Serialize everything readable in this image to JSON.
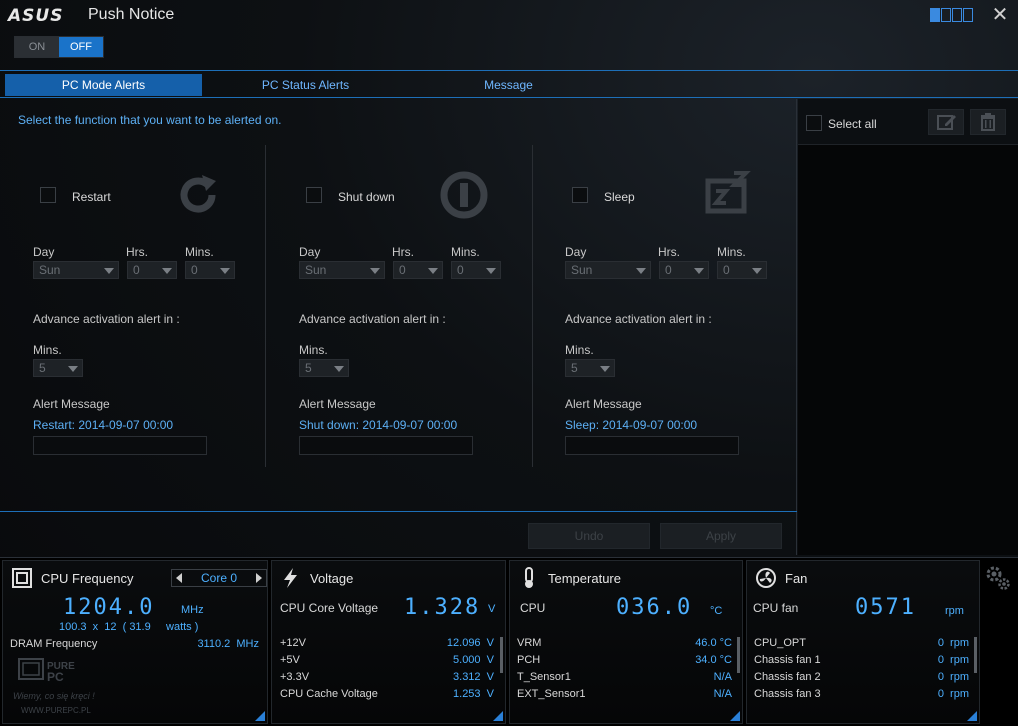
{
  "app": {
    "logo_text": "ASUS",
    "title": "Push Notice",
    "toggle": {
      "on_label": "ON",
      "off_label": "OFF"
    }
  },
  "tabs": [
    {
      "label": "PC Mode Alerts",
      "active": true
    },
    {
      "label": "PC Status Alerts",
      "active": false
    },
    {
      "label": "Message",
      "active": false
    }
  ],
  "main": {
    "instruction": "Select the function that you want to be alerted on.",
    "columns": [
      {
        "name": "Restart",
        "icon": "restart-icon",
        "day_label": "Day",
        "hrs_label": "Hrs.",
        "mins_label": "Mins.",
        "day": "Sun",
        "hrs": "0",
        "mins": "0",
        "advance_label": "Advance activation alert in :",
        "advance_mins_label": "Mins.",
        "advance_mins": "5",
        "alert_label": "Alert Message",
        "alert_msg": "Restart: 2014-09-07 00:00"
      },
      {
        "name": "Shut down",
        "icon": "power-icon",
        "day_label": "Day",
        "hrs_label": "Hrs.",
        "mins_label": "Mins.",
        "day": "Sun",
        "hrs": "0",
        "mins": "0",
        "advance_label": "Advance activation alert in :",
        "advance_mins_label": "Mins.",
        "advance_mins": "5",
        "alert_label": "Alert Message",
        "alert_msg": "Shut down: 2014-09-07 00:00"
      },
      {
        "name": "Sleep",
        "icon": "sleep-icon",
        "day_label": "Day",
        "hrs_label": "Hrs.",
        "mins_label": "Mins.",
        "day": "Sun",
        "hrs": "0",
        "mins": "0",
        "advance_label": "Advance activation alert in :",
        "advance_mins_label": "Mins.",
        "advance_mins": "5",
        "alert_label": "Alert Message",
        "alert_msg": "Sleep: 2014-09-07 00:00"
      }
    ],
    "undo_label": "Undo",
    "apply_label": "Apply"
  },
  "side": {
    "select_all_label": "Select all"
  },
  "dashboard": {
    "cpu": {
      "title": "CPU Frequency",
      "core_label": "Core 0",
      "freq": "1204.0",
      "freq_unit": "MHz",
      "detail": "100.3  x  12  ( 31.9     watts )",
      "dram_label": "DRAM Frequency",
      "dram_value": "3110.2  MHz"
    },
    "voltage": {
      "title": "Voltage",
      "main_label": "CPU Core Voltage",
      "main_value": "1.328",
      "main_unit": "V",
      "rows": [
        {
          "label": "+12V",
          "value": "12.096  V"
        },
        {
          "label": "+5V",
          "value": "5.000  V"
        },
        {
          "label": "+3.3V",
          "value": "3.312  V"
        },
        {
          "label": "CPU Cache Voltage",
          "value": "1.253  V"
        }
      ]
    },
    "temperature": {
      "title": "Temperature",
      "main_label": "CPU",
      "main_value": "036.0",
      "main_unit": "°C",
      "rows": [
        {
          "label": "VRM",
          "value": "46.0 °C"
        },
        {
          "label": "PCH",
          "value": "34.0 °C"
        },
        {
          "label": "T_Sensor1",
          "value": "N/A"
        },
        {
          "label": "EXT_Sensor1",
          "value": "N/A"
        }
      ]
    },
    "fan": {
      "title": "Fan",
      "main_label": "CPU fan",
      "main_value": "0571",
      "main_unit": "rpm",
      "rows": [
        {
          "label": "CPU_OPT",
          "value": "0  rpm"
        },
        {
          "label": "Chassis fan 1",
          "value": "0  rpm"
        },
        {
          "label": "Chassis fan 2",
          "value": "0  rpm"
        },
        {
          "label": "Chassis fan 3",
          "value": "0  rpm"
        }
      ]
    },
    "watermark": {
      "brand": "PURE PC",
      "tagline": "Wiemy, co się kręci !",
      "url": "WWW.PUREPC.PL"
    }
  },
  "colors": {
    "accent": "#1a73c9",
    "value_blue": "#4db0ff",
    "link_blue": "#5db0f5"
  }
}
